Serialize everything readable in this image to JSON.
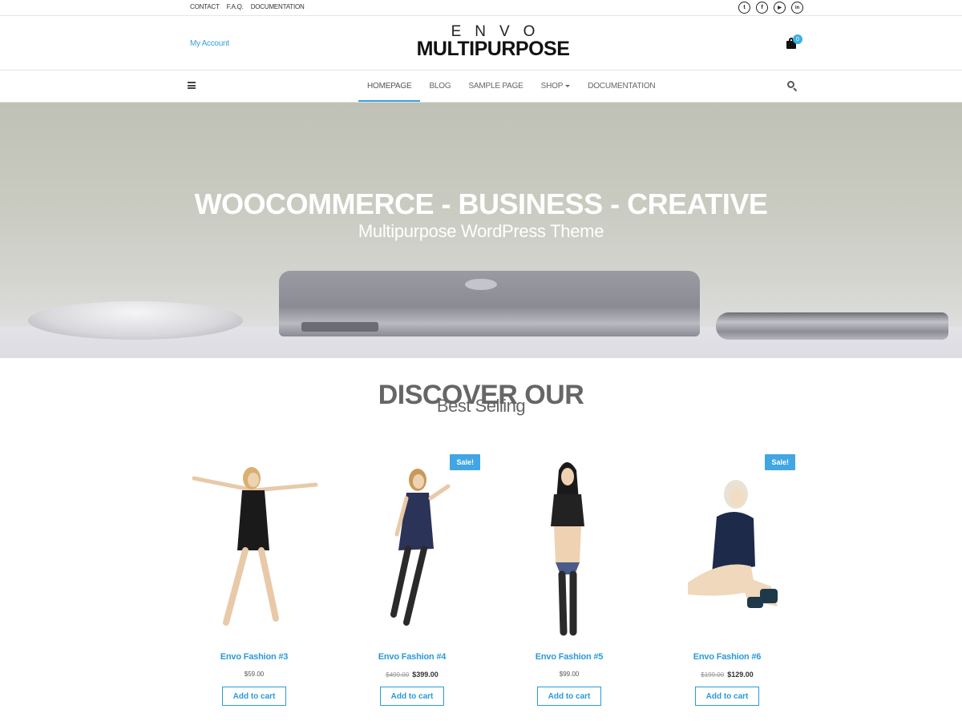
{
  "topbar": {
    "links": [
      "CONTACT",
      "F.A.Q.",
      "DOCUMENTATION"
    ],
    "social": [
      {
        "icon": "twitter-icon",
        "glyph": "t"
      },
      {
        "icon": "facebook-icon",
        "glyph": "f"
      },
      {
        "icon": "youtube-icon",
        "glyph": "▶"
      },
      {
        "icon": "linkedin-icon",
        "glyph": "in"
      }
    ]
  },
  "header": {
    "my_account": "My Account",
    "logo_top": "ENVO",
    "logo_bottom": "MULTIPURPOSE",
    "cart_count": "0"
  },
  "nav": {
    "items": [
      {
        "label": "HOMEPAGE",
        "active": true
      },
      {
        "label": "BLOG"
      },
      {
        "label": "SAMPLE PAGE"
      },
      {
        "label": "SHOP",
        "dropdown": true
      },
      {
        "label": "DOCUMENTATION"
      }
    ]
  },
  "hero": {
    "title": "WOOCOMMERCE - BUSINESS - CREATIVE",
    "subtitle": "Multipurpose WordPress Theme"
  },
  "section": {
    "title": "DISCOVER OUR",
    "subtitle": "Best Selling"
  },
  "colors": {
    "accent": "#2a9ad8",
    "sale_badge": "#41a6e3"
  },
  "products": [
    {
      "name": "Envo Fashion #3",
      "price": "$59.00",
      "old_price": "",
      "sale": false,
      "button": "Add to cart",
      "dress": "#1a1a1a",
      "hair": "#d9b070"
    },
    {
      "name": "Envo Fashion #4",
      "price": "$399.00",
      "old_price": "$499.00",
      "sale": true,
      "sale_label": "Sale!",
      "button": "Add to cart",
      "dress": "#2b3358",
      "hair": "#c89a5a"
    },
    {
      "name": "Envo Fashion #5",
      "price": "$99.00",
      "old_price": "",
      "sale": false,
      "button": "Add to cart",
      "dress": "#222222",
      "hair": "#1a1a1a"
    },
    {
      "name": "Envo Fashion #6",
      "price": "$129.00",
      "old_price": "$199.00",
      "sale": true,
      "sale_label": "Sale!",
      "button": "Add to cart",
      "dress": "#1d2a4a",
      "hair": "#e8e2d4"
    }
  ]
}
